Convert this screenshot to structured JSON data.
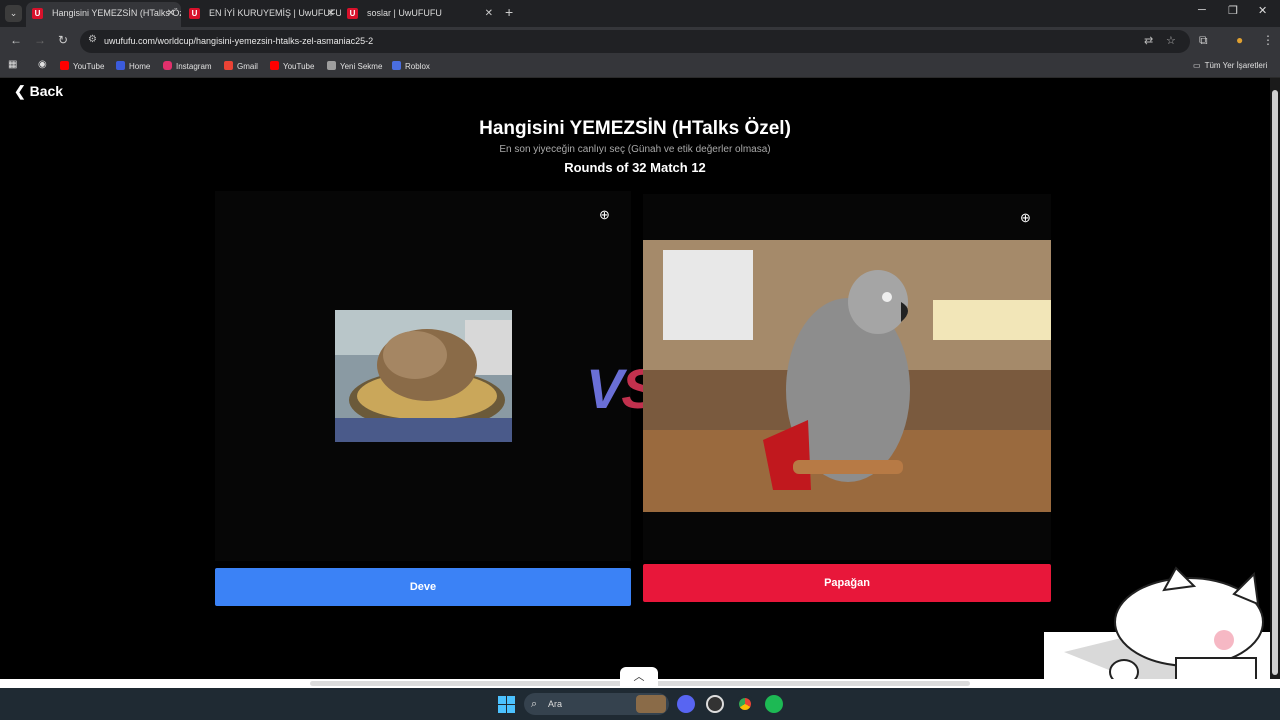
{
  "browser": {
    "tabs": [
      {
        "title": "Hangisini YEMEZSİN (HTalks Öz",
        "favicon": "U",
        "active": true
      },
      {
        "title": "EN İYİ KURUYEMİŞ | UwUFUFU",
        "favicon": "U",
        "active": false
      },
      {
        "title": "soslar | UwUFUFU",
        "favicon": "U",
        "active": false
      }
    ],
    "url": "uwufufu.com/worldcup/hangisini-yemezsin-htalks-zel-asmaniac25-2",
    "bookmarks": [
      {
        "label": "YouTube",
        "color": "#ff0000"
      },
      {
        "label": "Home",
        "color": "#3b5bdb"
      },
      {
        "label": "Instagram",
        "color": "#e1306c"
      },
      {
        "label": "Gmail",
        "color": "#ea4335"
      },
      {
        "label": "YouTube",
        "color": "#ff0000"
      },
      {
        "label": "Yeni Sekme",
        "color": "#9e9e9e"
      },
      {
        "label": "Roblox",
        "color": "#4a6ee0"
      }
    ],
    "all_bookmarks": "Tüm Yer İşaretleri"
  },
  "page": {
    "back_label": "Back",
    "title": "Hangisini YEMEZSİN (HTalks Özel)",
    "subtitle": "En son yiyeceğin canlıyı seç (Günah ve etik değerler olmasa)",
    "round": "Rounds of 32 Match 12",
    "vs_v": "V",
    "vs_s": "S",
    "left_choice": {
      "label": "Deve",
      "color": "#3b82f6"
    },
    "right_choice": {
      "label": "Papağan",
      "color": "#e8173a"
    }
  },
  "taskbar": {
    "search_placeholder": "Ara"
  },
  "colors": {
    "accent_blue": "#3b82f6",
    "accent_red": "#e8173a"
  }
}
